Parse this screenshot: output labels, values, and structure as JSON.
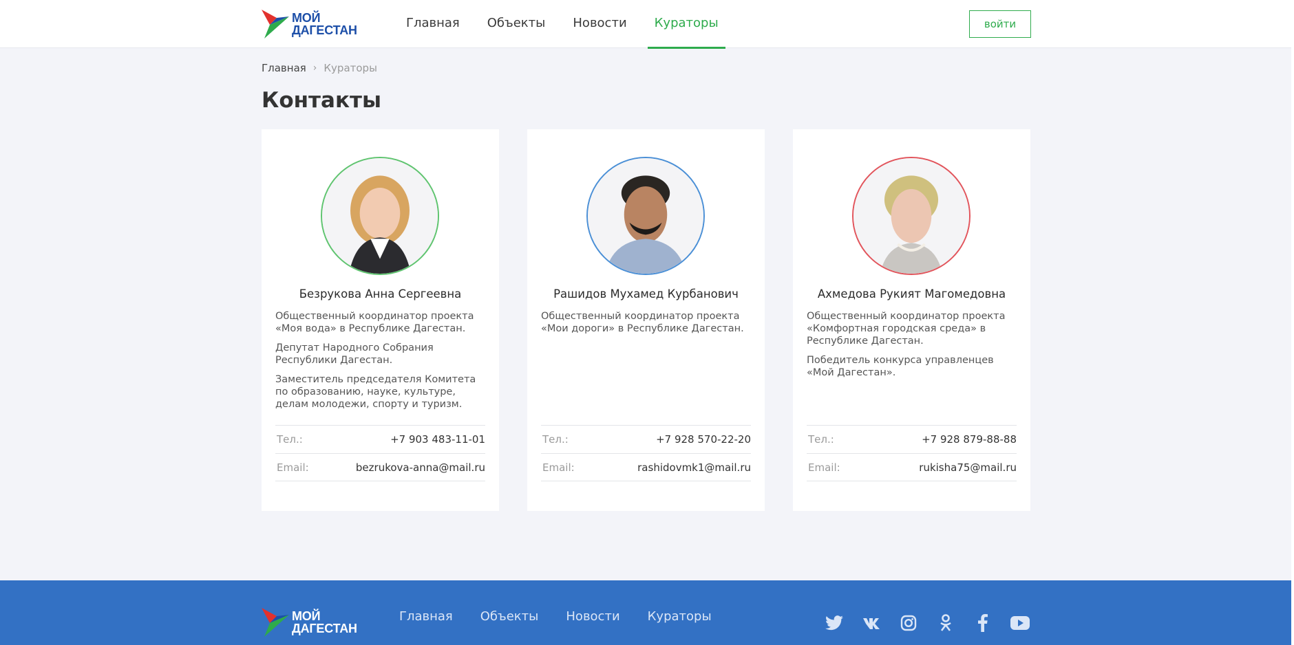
{
  "header": {
    "logo": {
      "line1": "МОЙ",
      "line2": "ДАГЕСТАН"
    },
    "nav": [
      {
        "label": "Главная",
        "active": false
      },
      {
        "label": "Объекты",
        "active": false
      },
      {
        "label": "Новости",
        "active": false
      },
      {
        "label": "Кураторы",
        "active": true
      }
    ],
    "login_label": "войти"
  },
  "breadcrumb": {
    "home": "Главная",
    "current": "Кураторы"
  },
  "page_title": "Контакты",
  "cards": [
    {
      "name": "Безрукова Анна Сергеевна",
      "ring_color": "#5fc46f",
      "desc": [
        "Общественный координатор проекта «Моя вода» в Республике Дагестан.",
        "Депутат Народного Собрания Республики Дагестан.",
        "Заместитель председателя Комитета по образованию, науке, культуре, делам молодежи, спорту и туризм."
      ],
      "phone_label": "Тел.:",
      "phone": "+7 903 483-11-01",
      "email_label": "Email:",
      "email": "bezrukova-anna@mail.ru"
    },
    {
      "name": "Рашидов Мухамед Курбанович",
      "ring_color": "#4a8fd6",
      "desc": [
        "Общественный координатор проекта «Мои дороги» в Республике Дагестан."
      ],
      "phone_label": "Тел.:",
      "phone": "+7 928 570-22-20",
      "email_label": "Email:",
      "email": "rashidovmk1@mail.ru"
    },
    {
      "name": "Ахмедова Рукият Магомедовна",
      "ring_color": "#e2545b",
      "desc": [
        "Общественный координатор проекта «Комфортная городская среда» в Республике Дагестан.",
        "Победитель конкурса управленцев «Мой Дагестан»."
      ],
      "phone_label": "Тел.:",
      "phone": "+7 928 879-88-88",
      "email_label": "Email:",
      "email": "rukisha75@mail.ru"
    }
  ],
  "footer": {
    "logo": {
      "line1": "МОЙ",
      "line2": "ДАГЕСТАН"
    },
    "nav": [
      "Главная",
      "Объекты",
      "Новости",
      "Кураторы"
    ],
    "socials": [
      "twitter-icon",
      "vk-icon",
      "instagram-icon",
      "odnoklassniki-icon",
      "facebook-icon",
      "youtube-icon"
    ]
  },
  "colors": {
    "accent_green": "#2eab4c",
    "brand_blue": "#1d4fa8",
    "footer_blue": "#3371c4"
  }
}
